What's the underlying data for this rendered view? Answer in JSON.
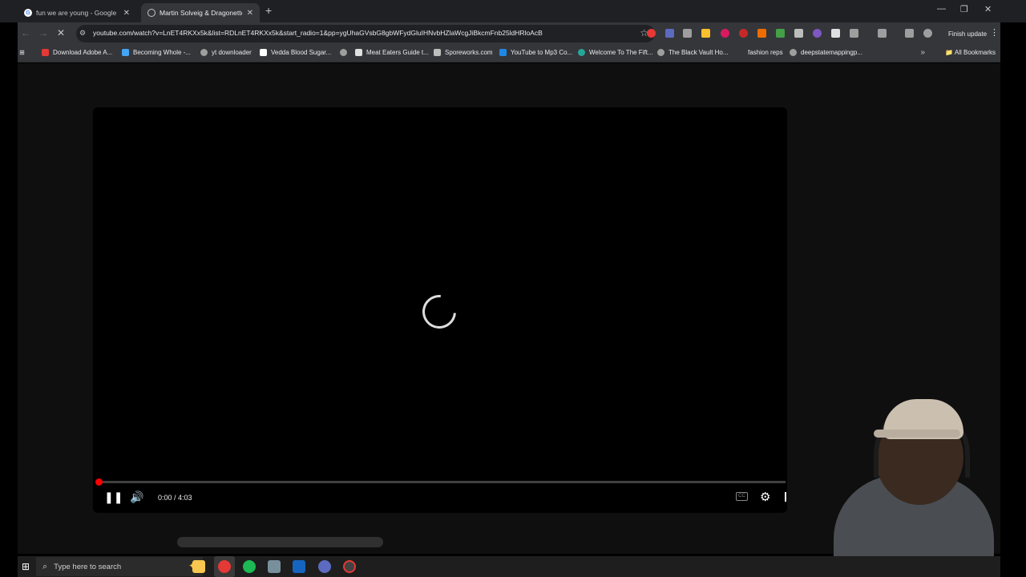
{
  "browser": {
    "tabs": [
      {
        "title": "fun we are young - Google Sea",
        "active": false
      },
      {
        "title": "Martin Solveig & Dragonette - ",
        "active": true
      }
    ],
    "new_tab": "+",
    "window_controls": {
      "minimize": "—",
      "restore": "❐",
      "close": "✕"
    },
    "url": "youtube.com/watch?v=LnET4RKXx5k&list=RDLnET4RKXx5k&start_radio=1&pp=ygUhaGVsbG8gbWFydGluIHNvbHZlaWcgJiBkcmFnb25ldHRloAcB",
    "finish_update": "Finish update",
    "bookmarks": [
      "Download Adobe A...",
      "Becoming Whole -...",
      "yt downloader",
      "Vedda Blood Sugar...",
      "",
      "Meat Eaters Guide t...",
      "Sporeworks.com",
      "YouTube to Mp3 Co...",
      "Welcome To The Fift...",
      "The Black Vault Ho...",
      "fashion reps",
      "deepstatemappingp..."
    ],
    "more_bookmarks": "»",
    "all_bookmarks": "All Bookmarks"
  },
  "player": {
    "state": "loading",
    "time_display": "0:00 / 4:03",
    "progress": 0,
    "cc_label": "CC"
  },
  "taskbar": {
    "search_placeholder": "Type here to search"
  },
  "colors": {
    "accent_red": "#ff0000",
    "chrome_dark": "#35363a",
    "page_bg": "#0f0f0f"
  }
}
